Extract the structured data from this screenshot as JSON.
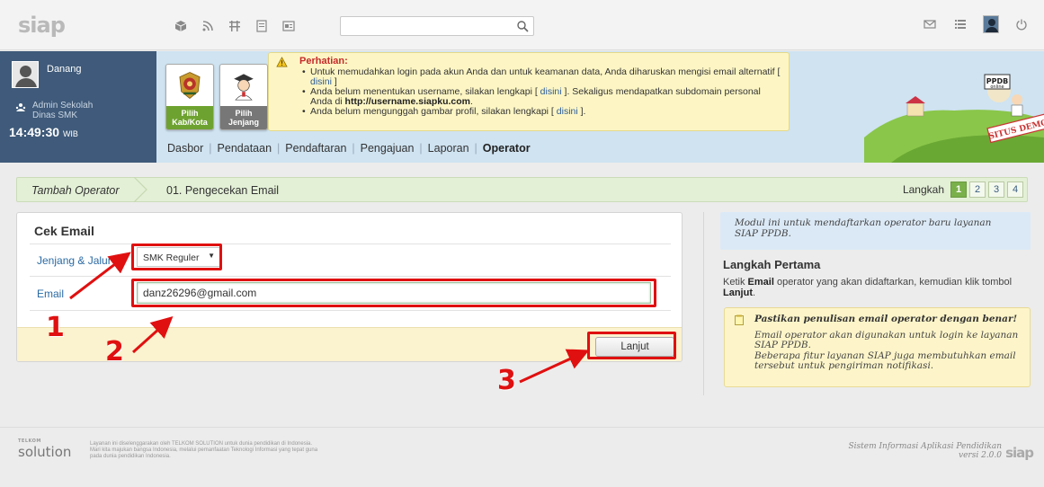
{
  "app": {
    "logo": "siap"
  },
  "topbar": {
    "search_placeholder": "",
    "icons": [
      "cube-icon",
      "rss-icon",
      "grid-icon",
      "list-icon",
      "id-icon"
    ],
    "right_icons": [
      "mail-icon",
      "menu-icon",
      "avatar",
      "power-icon"
    ]
  },
  "user": {
    "name": "Danang",
    "role_line1": "Admin Sekolah",
    "role_line2": "Dinas SMK",
    "time": "14:49:30",
    "tz": "WIB"
  },
  "cards": [
    {
      "label_line1": "Pilih",
      "label_line2": "Kab/Kota"
    },
    {
      "label_line1": "Pilih",
      "label_line2": "Jenjang"
    }
  ],
  "notice": {
    "title": "Perhatian:",
    "item1": "Untuk memudahkan login pada akun Anda dan untuk keamanan data, Anda diharuskan mengisi email alternatif [",
    "item1_link": "disini",
    "item1_end": "]",
    "item2": "Anda belum menentukan username, silakan lengkapi [",
    "item2_link": "disini",
    "item2_mid": "]. Sekaligus mendapatkan subdomain personal Anda di",
    "item2_url": "http://username.siapku.com",
    "item2_end": ".",
    "item3": "Anda belum mengunggah gambar profil, silakan lengkapi [",
    "item3_link": "disini",
    "item3_end": "]."
  },
  "nav": [
    {
      "label": "Dasbor"
    },
    {
      "label": "Pendataan"
    },
    {
      "label": "Pendaftaran"
    },
    {
      "label": "Pengajuan"
    },
    {
      "label": "Laporan"
    },
    {
      "label": "Operator"
    }
  ],
  "banner": {
    "badge": "PPDB",
    "badge_sub": "online",
    "demo": "SITUS DEMO"
  },
  "breadcrumb": {
    "section": "Tambah Operator",
    "page": "01. Pengecekan Email",
    "steps_label": "Langkah",
    "steps": [
      "1",
      "2",
      "3",
      "4"
    ],
    "active_step": 1
  },
  "form": {
    "title": "Cek Email",
    "jenjang_label": "Jenjang & Jalur",
    "jenjang_value": "SMK Reguler",
    "email_label": "Email",
    "email_value": "danz26296@gmail.com",
    "submit_label": "Lanjut"
  },
  "annotations": [
    "1",
    "2",
    "3"
  ],
  "info": {
    "intro": "Modul ini untuk mendaftarkan operator baru layanan SIAP PPDB.",
    "heading": "Langkah Pertama",
    "text_pre": "Ketik",
    "text_bold1": "Email",
    "text_mid": "operator yang akan didaftarkan, kemudian klik tombol",
    "text_bold2": "Lanjut",
    "text_end": ".",
    "tip_title": "Pastikan penulisan email operator dengan benar!",
    "tip_line1": "Email operator akan digunakan untuk login ke layanan SIAP PPDB.",
    "tip_line2": "Beberapa fitur layanan SIAP juga membutuhkan email tersebut untuk pengiriman notifikasi."
  },
  "footer": {
    "telkom": "TELKOM",
    "logo": "solution",
    "text1": "Layanan ini diselenggarakan oleh TELKOM SOLUTION untuk dunia pendidikan di Indonesia.",
    "text2": "Mari kita majukan bangsa Indonesia, melalui pemanfaatan Teknologi Informasi yang tepat guna",
    "text3": "pada dunia pendidikan Indonesia.",
    "right1": "Sistem Informasi Aplikasi Pendidikan",
    "right2": "versi 2.0.0",
    "right_logo": "siap"
  },
  "colors": {
    "accent_red": "#e01010",
    "nav_blue": "#3f5a7a",
    "step_green": "#7ab04a"
  }
}
